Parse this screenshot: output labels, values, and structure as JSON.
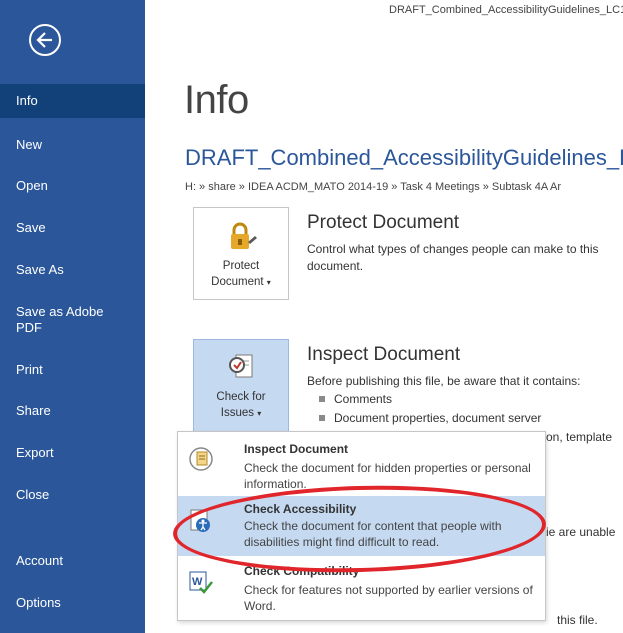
{
  "window": {
    "filename": "DRAFT_Combined_AccessibilityGuidelines_LC1"
  },
  "sidebar": {
    "back_icon": "back-arrow-icon",
    "items": [
      {
        "label": "Info",
        "active": true
      },
      {
        "label": "New"
      },
      {
        "label": "Open"
      },
      {
        "label": "Save"
      },
      {
        "label": "Save As"
      },
      {
        "label": "Save as Adobe PDF"
      },
      {
        "label": "Print"
      },
      {
        "label": "Share"
      },
      {
        "label": "Export"
      },
      {
        "label": "Close"
      },
      {
        "label": "Account"
      },
      {
        "label": "Options"
      }
    ]
  },
  "main": {
    "title": "Info",
    "doc_title": "DRAFT_Combined_AccessibilityGuidelines_L",
    "path": "H: » share » IDEA ACDM_MATO 2014-19 » Task 4 Meetings » Subtask 4A Ar",
    "protect": {
      "button_line1": "Protect",
      "button_line2": "Document",
      "heading": "Protect Document",
      "desc": "Control what types of changes people can make to this document."
    },
    "inspect": {
      "button_line1": "Check for",
      "button_line2": "Issues",
      "heading": "Inspect Document",
      "desc": "Before publishing this file, be aware that it contains:",
      "bullets": [
        "Comments",
        "Document properties, document server"
      ],
      "partial1": "on, template",
      "partial2": "ie are unable",
      "partial3": "this file."
    }
  },
  "dropdown": {
    "items": [
      {
        "title": "Inspect Document",
        "desc": "Check the document for hidden properties or personal information.",
        "icon": "inspect-document-icon"
      },
      {
        "title": "Check Accessibility",
        "desc": "Check the document for content that people with disabilities might find difficult to read.",
        "icon": "accessibility-icon",
        "highlighted": true
      },
      {
        "title": "Check Compatibility",
        "desc": "Check for features not supported by earlier versions of Word.",
        "icon": "word-compatibility-icon"
      }
    ]
  },
  "colors": {
    "sidebar": "#2b579a",
    "active_nav": "#124078",
    "accent_blue": "#2b579a",
    "highlight": "#c5d9f1",
    "annotation_red": "#e0262b"
  }
}
